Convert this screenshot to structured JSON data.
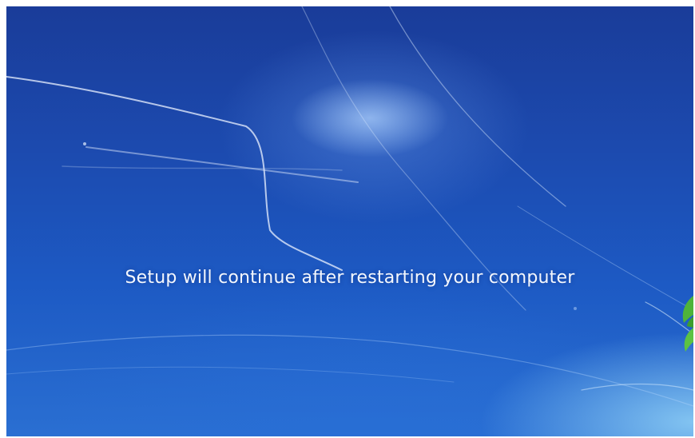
{
  "setup": {
    "status_message": "Setup will continue after restarting your computer"
  },
  "colors": {
    "background_top": "#1a3c99",
    "background_bottom": "#2a6fd2",
    "text": "#f4f7fd",
    "leaf_green": "#4fb33a"
  },
  "icons": {
    "logo": "windows-logo-icon"
  }
}
